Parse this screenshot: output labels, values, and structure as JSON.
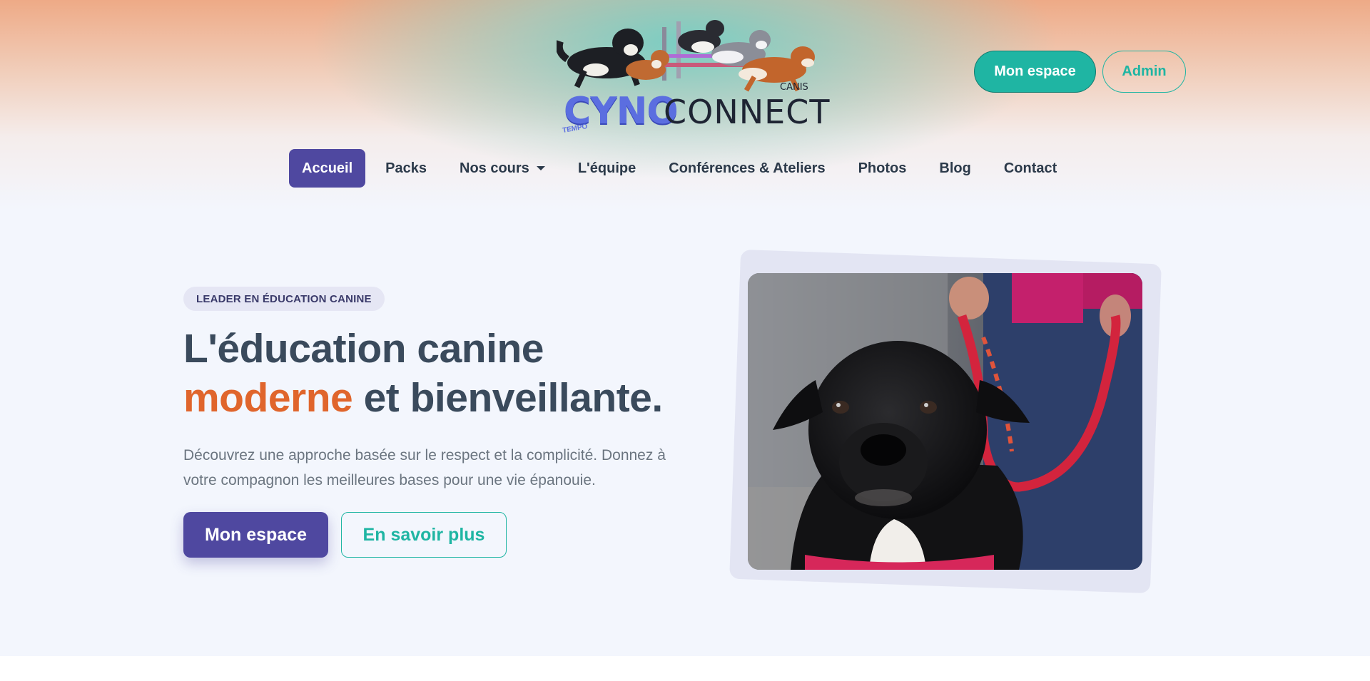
{
  "brand": {
    "name_part1": "CYNO",
    "name_part2": "CONNECT",
    "superscript": "CANIS",
    "tag": "TEMPO"
  },
  "header": {
    "account_button": "Mon espace",
    "admin_button": "Admin"
  },
  "nav": {
    "items": [
      {
        "label": "Accueil",
        "active": true
      },
      {
        "label": "Packs"
      },
      {
        "label": "Nos cours",
        "dropdown": true
      },
      {
        "label": "L'équipe"
      },
      {
        "label": "Conférences & Ateliers"
      },
      {
        "label": "Photos"
      },
      {
        "label": "Blog"
      },
      {
        "label": "Contact"
      }
    ]
  },
  "hero": {
    "badge": "LEADER EN ÉDUCATION CANINE",
    "title_line1": "L'éducation canine",
    "title_accent": "moderne",
    "title_rest": " et bienveillante.",
    "description": "Découvrez une approche basée sur le respect et la complicité. Donnez à votre compagnon les meilleures bases pour une vie épanouie.",
    "primary_button": "Mon espace",
    "secondary_button": "En savoir plus"
  },
  "colors": {
    "primary": "#4f48a0",
    "teal": "#1fb5a3",
    "accent": "#e0652c",
    "heading": "#3a4a5c"
  }
}
